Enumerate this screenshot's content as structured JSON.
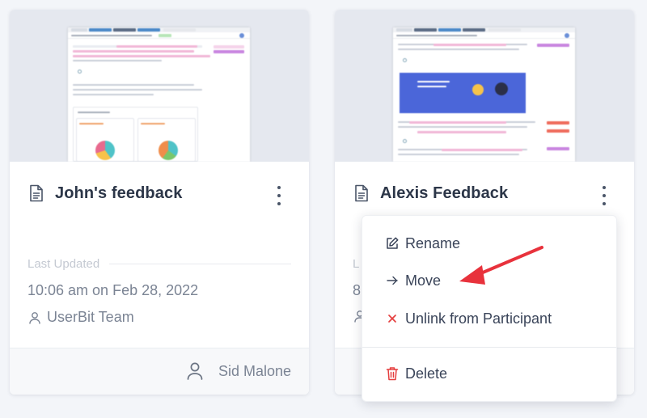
{
  "cards": [
    {
      "title": "John's feedback",
      "updated_label": "Last Updated",
      "updated_value": "10:06 am on Feb 28, 2022",
      "team": "UserBit Team",
      "owner": "Sid Malone"
    },
    {
      "title": "Alexis Feedback",
      "updated_label": "L",
      "updated_value": "8",
      "team": "",
      "owner": ""
    }
  ],
  "menu": {
    "rename": "Rename",
    "move": "Move",
    "unlink": "Unlink from Participant",
    "delete": "Delete"
  },
  "colors": {
    "accent_red": "#e8323c",
    "danger": "#e53e3e",
    "text_primary": "#2c3648",
    "text_muted": "#7b8494"
  },
  "icons": {
    "document": "document-icon",
    "kebab": "kebab-menu-icon",
    "user": "user-icon",
    "edit": "edit-icon",
    "arrow_right": "arrow-right-icon",
    "close": "close-icon",
    "trash": "trash-icon"
  }
}
